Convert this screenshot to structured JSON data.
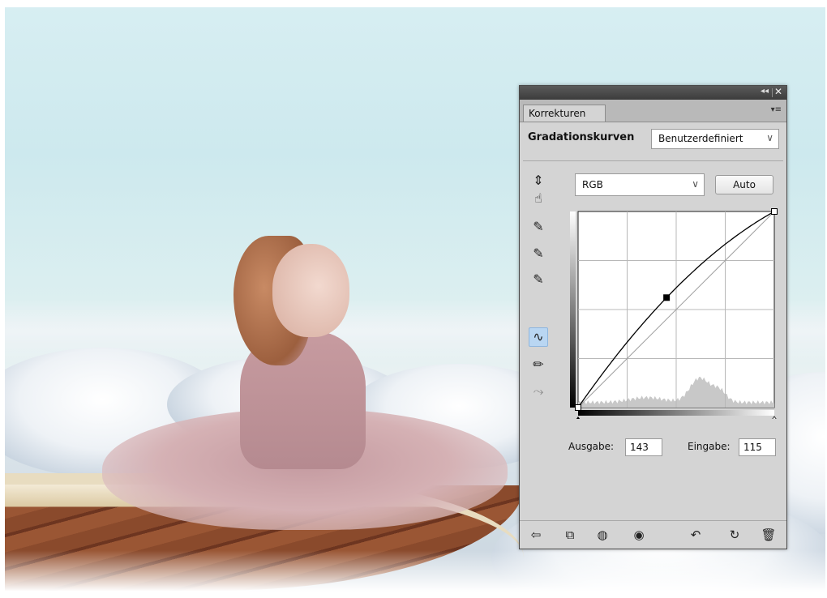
{
  "panel": {
    "tab_label": "Korrekturen",
    "adjustment_title": "Gradationskurven",
    "preset_value": "Benutzerdefiniert",
    "channel_value": "RGB",
    "auto_label": "Auto",
    "output_label": "Ausgabe:",
    "output_value": "143",
    "input_label": "Eingabe:",
    "input_value": "115",
    "collapse_glyph": "◂◂",
    "close_glyph": "✕",
    "menu_glyph": "▾≡"
  },
  "tools": [
    {
      "name": "on-image-adjust-icon",
      "glyph": "⇕☝"
    },
    {
      "name": "black-eyedropper-icon",
      "glyph": "✎"
    },
    {
      "name": "gray-eyedropper-icon",
      "glyph": "✎"
    },
    {
      "name": "white-eyedropper-icon",
      "glyph": "✎"
    },
    {
      "name": "curve-point-tool-icon",
      "glyph": "∿"
    },
    {
      "name": "pencil-draw-icon",
      "glyph": "✏"
    },
    {
      "name": "smooth-curve-icon",
      "glyph": "⤳"
    }
  ],
  "curve": {
    "input_range": [
      0,
      255
    ],
    "output_range": [
      0,
      255
    ],
    "control_points": [
      [
        0,
        0
      ],
      [
        115,
        143
      ],
      [
        255,
        255
      ]
    ],
    "grid_divisions": 4
  },
  "bottom_icons": [
    "back-arrow-icon",
    "clip-to-layer-icon",
    "layer-visibility-icon",
    "eye-icon",
    "view-previous-icon",
    "reset-icon",
    "trash-icon"
  ]
}
